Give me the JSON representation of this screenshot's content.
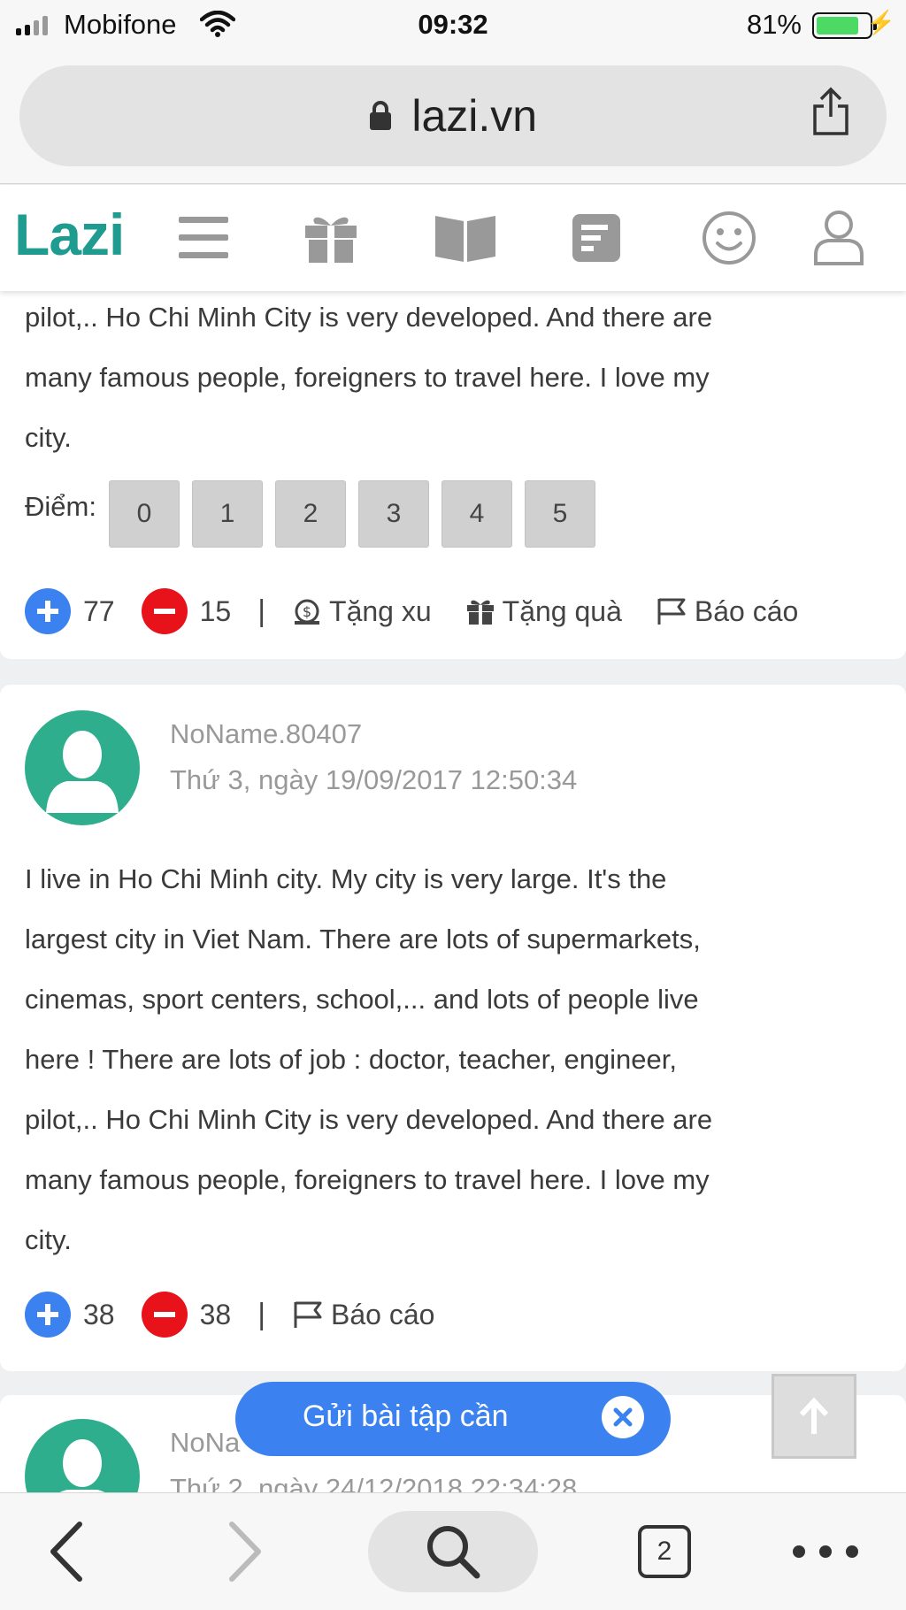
{
  "status_bar": {
    "carrier": "Mobifone",
    "time": "09:32",
    "battery_percent": "81%",
    "battery_level": 0.81
  },
  "browser": {
    "url": "lazi.vn",
    "tabs_count": "2"
  },
  "site": {
    "logo": "Lazi",
    "nav_icons": [
      "menu-icon",
      "gift-icon",
      "book-icon",
      "document-icon",
      "smiley-icon",
      "user-icon"
    ]
  },
  "answer1": {
    "text_lines": [
      "pilot,.. Ho Chi Minh City is very developed. And there are",
      "many famous people, foreigners to travel here. I love my",
      "city."
    ],
    "score_label": "Điểm:",
    "score_options": [
      "0",
      "1",
      "2",
      "3",
      "4",
      "5"
    ],
    "upvotes": "77",
    "downvotes": "15",
    "separator": "|",
    "gift_coin_label": "Tặng xu",
    "gift_label": "Tặng quà",
    "report_label": "Báo cáo"
  },
  "answer2": {
    "username": "NoName.80407",
    "date": "Thứ 3, ngày 19/09/2017 12:50:34",
    "text_lines": [
      "I live in Ho Chi Minh city. My city is very large. It's the",
      "largest city in Viet Nam. There are lots of supermarkets,",
      "cinemas, sport centers, school,... and lots of people live",
      "here ! There are lots of job : doctor, teacher, engineer,",
      "pilot,.. Ho Chi Minh City is very developed. And there are",
      "many famous people, foreigners to travel here. I love my",
      "city."
    ],
    "upvotes": "38",
    "downvotes": "38",
    "separator": "|",
    "report_label": "Báo cáo"
  },
  "answer3": {
    "username": "NoNa",
    "date": "Thứ 2, ngày 24/12/2018 22:34:28"
  },
  "floating": {
    "submit_label": "Gửi bài tập cần"
  },
  "colors": {
    "brand": "#1f9b8f",
    "accent_blue": "#3b82f0",
    "downvote_red": "#e8121a",
    "avatar_green": "#2fae8e"
  }
}
